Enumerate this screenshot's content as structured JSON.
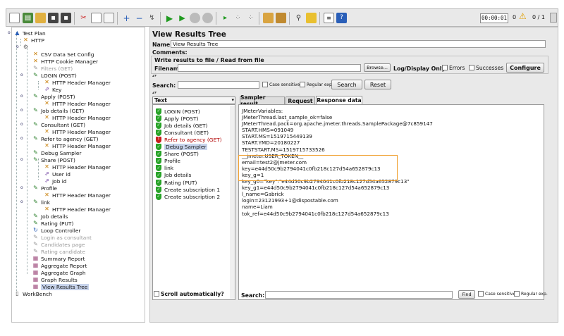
{
  "toolbar": {
    "timer": "00:00:01",
    "warnings": "0",
    "threads": "0 / 1",
    "icons": [
      "new-icon",
      "templates-icon",
      "open-icon",
      "save-icon",
      "save-as-icon",
      "cut-icon",
      "copy-icon",
      "paste-icon",
      "expand-icon",
      "collapse-icon",
      "toggle-icon",
      "start-icon",
      "start-no-timers-icon",
      "stop-icon",
      "shutdown-icon",
      "remote-start-icon",
      "remote-stop-icon",
      "remote-shutdown-icon",
      "clear-icon",
      "clear-all-icon",
      "search-icon",
      "reset-search-icon",
      "function-helper-icon",
      "help-icon"
    ]
  },
  "tree": {
    "items": [
      {
        "label": "Test Plan",
        "icon": "test-plan-icon"
      },
      {
        "label": "HTTP",
        "icon": "http-config-icon"
      },
      {
        "label": "",
        "icon": "thread-group-icon"
      },
      {
        "label": "CSV Data Set Config",
        "icon": "config-element-icon"
      },
      {
        "label": "HTTP Cookie Manager",
        "icon": "config-element-icon"
      },
      {
        "label": "Filters (GET)",
        "icon": "sampler-icon"
      },
      {
        "label": "LOGIN (POST)",
        "icon": "sampler-icon"
      },
      {
        "label": "HTTP Header Manager",
        "icon": "config-element-icon"
      },
      {
        "label": "Key",
        "icon": "post-processor-icon"
      },
      {
        "label": "Apply (POST)",
        "icon": "sampler-icon"
      },
      {
        "label": "HTTP Header Manager",
        "icon": "config-element-icon"
      },
      {
        "label": "Job details (GET)",
        "icon": "sampler-icon"
      },
      {
        "label": "HTTP Header Manager",
        "icon": "config-element-icon"
      },
      {
        "label": "Consultant (GET)",
        "icon": "sampler-icon"
      },
      {
        "label": "HTTP Header Manager",
        "icon": "config-element-icon"
      },
      {
        "label": "Refer to agency (GET)",
        "icon": "sampler-icon"
      },
      {
        "label": "HTTP Header Manager",
        "icon": "config-element-icon"
      },
      {
        "label": "Debug Sampler",
        "icon": "sampler-icon"
      },
      {
        "label": "Share (POST)",
        "icon": "sampler-icon"
      },
      {
        "label": "HTTP Header Manager",
        "icon": "config-element-icon"
      },
      {
        "label": "User id",
        "icon": "post-processor-icon"
      },
      {
        "label": "Job id",
        "icon": "post-processor-icon"
      },
      {
        "label": "Profile",
        "icon": "sampler-icon"
      },
      {
        "label": "HTTP Header Manager",
        "icon": "config-element-icon"
      },
      {
        "label": "link",
        "icon": "sampler-icon"
      },
      {
        "label": "HTTP Header Manager",
        "icon": "config-element-icon"
      },
      {
        "label": "Job details",
        "icon": "sampler-icon"
      },
      {
        "label": "Rating (PUT)",
        "icon": "sampler-icon"
      },
      {
        "label": "Loop Controller",
        "icon": "loop-controller-icon"
      },
      {
        "label": "Login as consultant",
        "icon": "sampler-icon"
      },
      {
        "label": "Candidates page",
        "icon": "sampler-icon"
      },
      {
        "label": "Rating candidate",
        "icon": "sampler-icon"
      },
      {
        "label": "Summary Report",
        "icon": "listener-icon"
      },
      {
        "label": "Aggregate Report",
        "icon": "listener-icon"
      },
      {
        "label": "Aggregate Graph",
        "icon": "listener-icon"
      },
      {
        "label": "Graph Results",
        "icon": "listener-icon"
      },
      {
        "label": "View Results Tree",
        "icon": "listener-icon"
      },
      {
        "label": "WorkBench",
        "icon": "workbench-icon"
      }
    ]
  },
  "panel": {
    "title": "View Results Tree",
    "name_label": "Name:",
    "name_value": "View Results Tree",
    "comments_label": "Comments:",
    "write_results": "Write results to file / Read from file",
    "filename_label": "Filename",
    "filename_value": "",
    "browse_label": "Browse...",
    "log_display_label": "Log/Display Only:",
    "errors_label": "Errors",
    "successes_label": "Successes",
    "configure_label": "Configure",
    "search_label": "Search:",
    "search_value": "",
    "case_sensitive_label": "Case sensitive",
    "regex_label": "Regular exp.",
    "search_button": "Search",
    "reset_button": "Reset",
    "renderer_value": "Text",
    "scroll_auto_label": "Scroll automatically?"
  },
  "results": [
    {
      "label": "LOGIN (POST)",
      "status": "success"
    },
    {
      "label": "Apply (POST)",
      "status": "success"
    },
    {
      "label": "Job details (GET)",
      "status": "success"
    },
    {
      "label": "Consultant (GET)",
      "status": "success"
    },
    {
      "label": "Refer to agency (GET)",
      "status": "error"
    },
    {
      "label": "Debug Sampler",
      "status": "success"
    },
    {
      "label": "Share (POST)",
      "status": "success"
    },
    {
      "label": "Profile",
      "status": "success"
    },
    {
      "label": "link",
      "status": "success"
    },
    {
      "label": "Job details",
      "status": "success"
    },
    {
      "label": "Rating (PUT)",
      "status": "success"
    },
    {
      "label": "Create subscription 1",
      "status": "success"
    },
    {
      "label": "Create subscription 2",
      "status": "success"
    }
  ],
  "tabs": [
    "Sampler result",
    "Request",
    "Response data"
  ],
  "response_lines": [
    "JMeterVariables:",
    "JMeterThread.last_sample_ok=false",
    "JMeterThread.pack=org.apache.jmeter.threads.SamplePackage@7c859147",
    "START.HMS=091049",
    "START.MS=1519715449139",
    "START.YMD=20180227",
    "TESTSTART.MS=1519715733526",
    "__jmeter.USER_TOKEN__",
    "email=test2@jmeter.com",
    "key=e44d50c9b2794041c0fb218c127d54a652879c13",
    "key_g=1",
    "key_g0=\"key\":\"e44d50c9b2794041c0fb218c127d54a652879c13\"",
    "key_g1=e44d50c9b2794041c0fb218c127d54a652879c13",
    "l_name=Gabrick",
    "login=23121993+1@dispostable.com",
    "name=Liam",
    "tok_ref=e44d50c9b2794041c0fb218c127d54a652879c13"
  ],
  "bottom_search": {
    "label": "Search:",
    "value": "",
    "find_label": "Find",
    "case_sensitive_label": "Case sensitive",
    "regex_label": "Regular exp."
  },
  "colors": {
    "success": "#27a327",
    "error": "#c81e1e",
    "highlight": "#f0a030",
    "selection": "#c8d4ec"
  }
}
